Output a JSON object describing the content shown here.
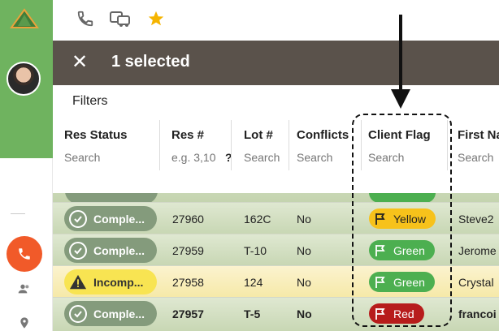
{
  "toolbar": {
    "icons": [
      "phone-icon",
      "vehicles-icon",
      "star-icon"
    ],
    "star_color": "#f5b400"
  },
  "selection": {
    "text": "1 selected",
    "close_glyph": "✕"
  },
  "filters": {
    "label": "Filters"
  },
  "columns": [
    {
      "title": "Res Status",
      "placeholder": "Search"
    },
    {
      "title": "Res #",
      "placeholder": "e.g. 3,10",
      "help": "?"
    },
    {
      "title": "Lot #",
      "placeholder": "Search"
    },
    {
      "title": "Conflicts",
      "placeholder": "Search"
    },
    {
      "title": "Client Flag",
      "placeholder": "Search"
    },
    {
      "title": "First Na",
      "placeholder": "Search"
    }
  ],
  "rows": [
    {
      "status": "Comple...",
      "status_type": "complete",
      "res": "27960",
      "lot": "162C",
      "conflicts": "No",
      "flag": "Yellow",
      "flag_color": "#f7c21b",
      "flag_text_color": "#222222",
      "first": "Steve2"
    },
    {
      "status": "Comple...",
      "status_type": "complete",
      "res": "27959",
      "lot": "T-10",
      "conflicts": "No",
      "flag": "Green",
      "flag_color": "#4caf50",
      "flag_text_color": "#ffffff",
      "first": "Jerome"
    },
    {
      "status": "Incomp...",
      "status_type": "incomplete",
      "res": "27958",
      "lot": "124",
      "conflicts": "No",
      "flag": "Green",
      "flag_color": "#4caf50",
      "flag_text_color": "#ffffff",
      "first": "Crystal"
    },
    {
      "status": "Comple...",
      "status_type": "complete",
      "res": "27957",
      "lot": "T-5",
      "conflicts": "No",
      "flag": "Red",
      "flag_color": "#b71c1c",
      "flag_text_color": "#ffffff",
      "first": "francoi"
    }
  ],
  "colors": {
    "rail_green": "#6fb35f",
    "selection_bar": "#5a524b",
    "phone_fab": "#f15a29"
  }
}
